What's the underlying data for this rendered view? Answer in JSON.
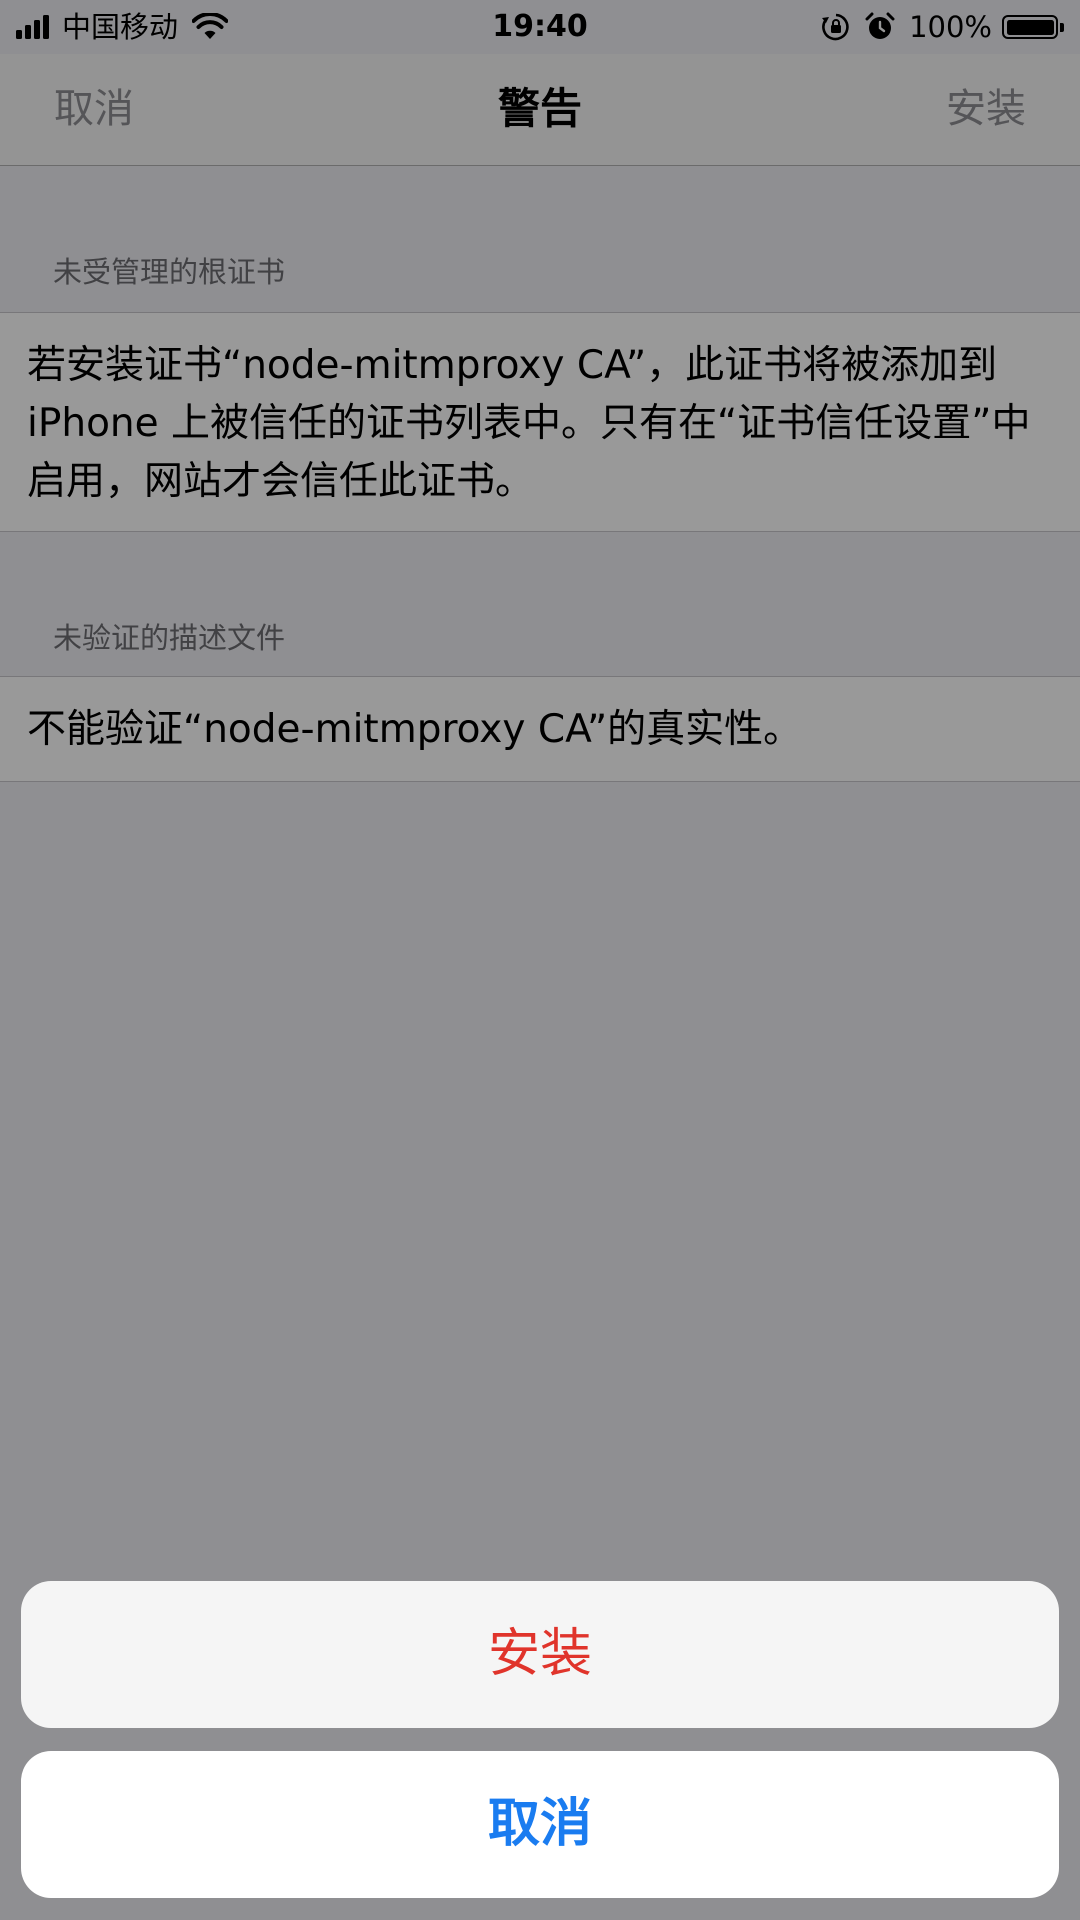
{
  "status_bar": {
    "carrier": "中国移动",
    "time": "19:40",
    "battery_percent": "100%",
    "battery_level": 1.0,
    "signal_bars": 4,
    "icons": [
      "signal-icon",
      "wifi-icon",
      "lock-rotation-icon",
      "alarm-icon",
      "battery-icon"
    ]
  },
  "nav": {
    "cancel_label": "取消",
    "title": "警告",
    "install_label": "安装"
  },
  "sections": [
    {
      "header": "未受管理的根证书",
      "body": "若安装证书“node-mitmproxy CA”，此证书将被添加到 iPhone 上被信任的证书列表中。只有在“证书信任设置”中启用，网站才会信任此证书。"
    },
    {
      "header": "未验证的描述文件",
      "body": "不能验证“node-mitmproxy CA”的真实性。"
    }
  ],
  "action_sheet": {
    "install_label": "安装",
    "cancel_label": "取消"
  },
  "colors": {
    "destructive": "#e0342b",
    "accent": "#1a7cf0",
    "section_header": "#6d6d72",
    "nav_disabled": "#8e8e93"
  }
}
